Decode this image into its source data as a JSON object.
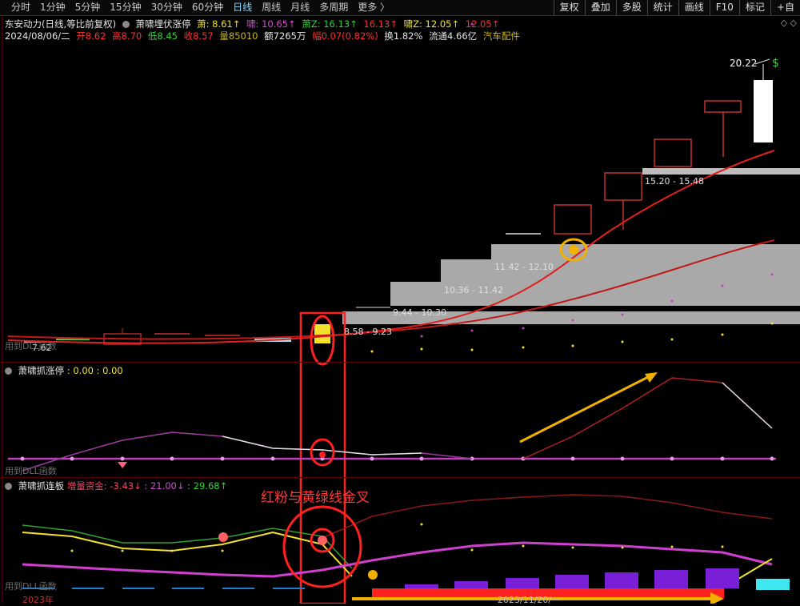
{
  "toolbar": {
    "tabs": [
      "分时",
      "1分钟",
      "5分钟",
      "15分钟",
      "30分钟",
      "60分钟",
      "日线",
      "周线",
      "月线",
      "多周期",
      "更多 〉"
    ],
    "tools": [
      "复权",
      "叠加",
      "多股",
      "统计",
      "画线",
      "F10",
      "标记",
      "+自"
    ]
  },
  "header": {
    "title": "东安动力(日线,等比前复权)",
    "indicator_name": "萧啸埋伏涨停",
    "xiao_label": "萧: 8.61↑",
    "xiao_color": "#f2e22b",
    "xiao2_label": "啸: 10.65↑",
    "xiao2_color": "#d54dd5",
    "xz_label": "萧Z: 16.13↑",
    "xz_color": "#31d431",
    "val_label": "16.13↑",
    "val_color": "#ff3030",
    "xiaoz_label": "啸Z: 12.05↑",
    "xiaoz_color": "#f2e22b",
    "val2_label": "12.05↑",
    "val2_color": "#ff3030"
  },
  "quote": {
    "date": "2024/08/06/二",
    "open": "开8.62",
    "high": "高8.70",
    "low": "低8.45",
    "close": "收8.57",
    "volume": "量85010",
    "amount": "额7265万",
    "change": "幅0.07(0.82%)",
    "turnover": "换1.82%",
    "float_cap": "流通4.66亿",
    "sector": "汽车配件"
  },
  "main_chart": {
    "peak_label": "20.22",
    "low_label": "7.62",
    "zones": [
      "15.20 - 15.48",
      "11.42 - 12.10",
      "10.36 - 11.42",
      "9.44 - 10.30",
      "8.58 - 9.23"
    ],
    "watermark": "用到DLL函数"
  },
  "panel2": {
    "title": "萧啸抓涨停",
    "values": ": 0.00 : 0.00",
    "watermark": "用到DLL函数"
  },
  "panel3": {
    "title": "萧啸抓连板",
    "fund_label": "增量资金:",
    "fund_value": "-3.43↓",
    "val2": ": 21.00↓",
    "val3": ": 29.68↑",
    "watermark": "用到DLL函数",
    "year": "2023年",
    "date_bottom": "2023/11/20/一"
  },
  "annotation": "红粉与黄绿线金叉"
}
